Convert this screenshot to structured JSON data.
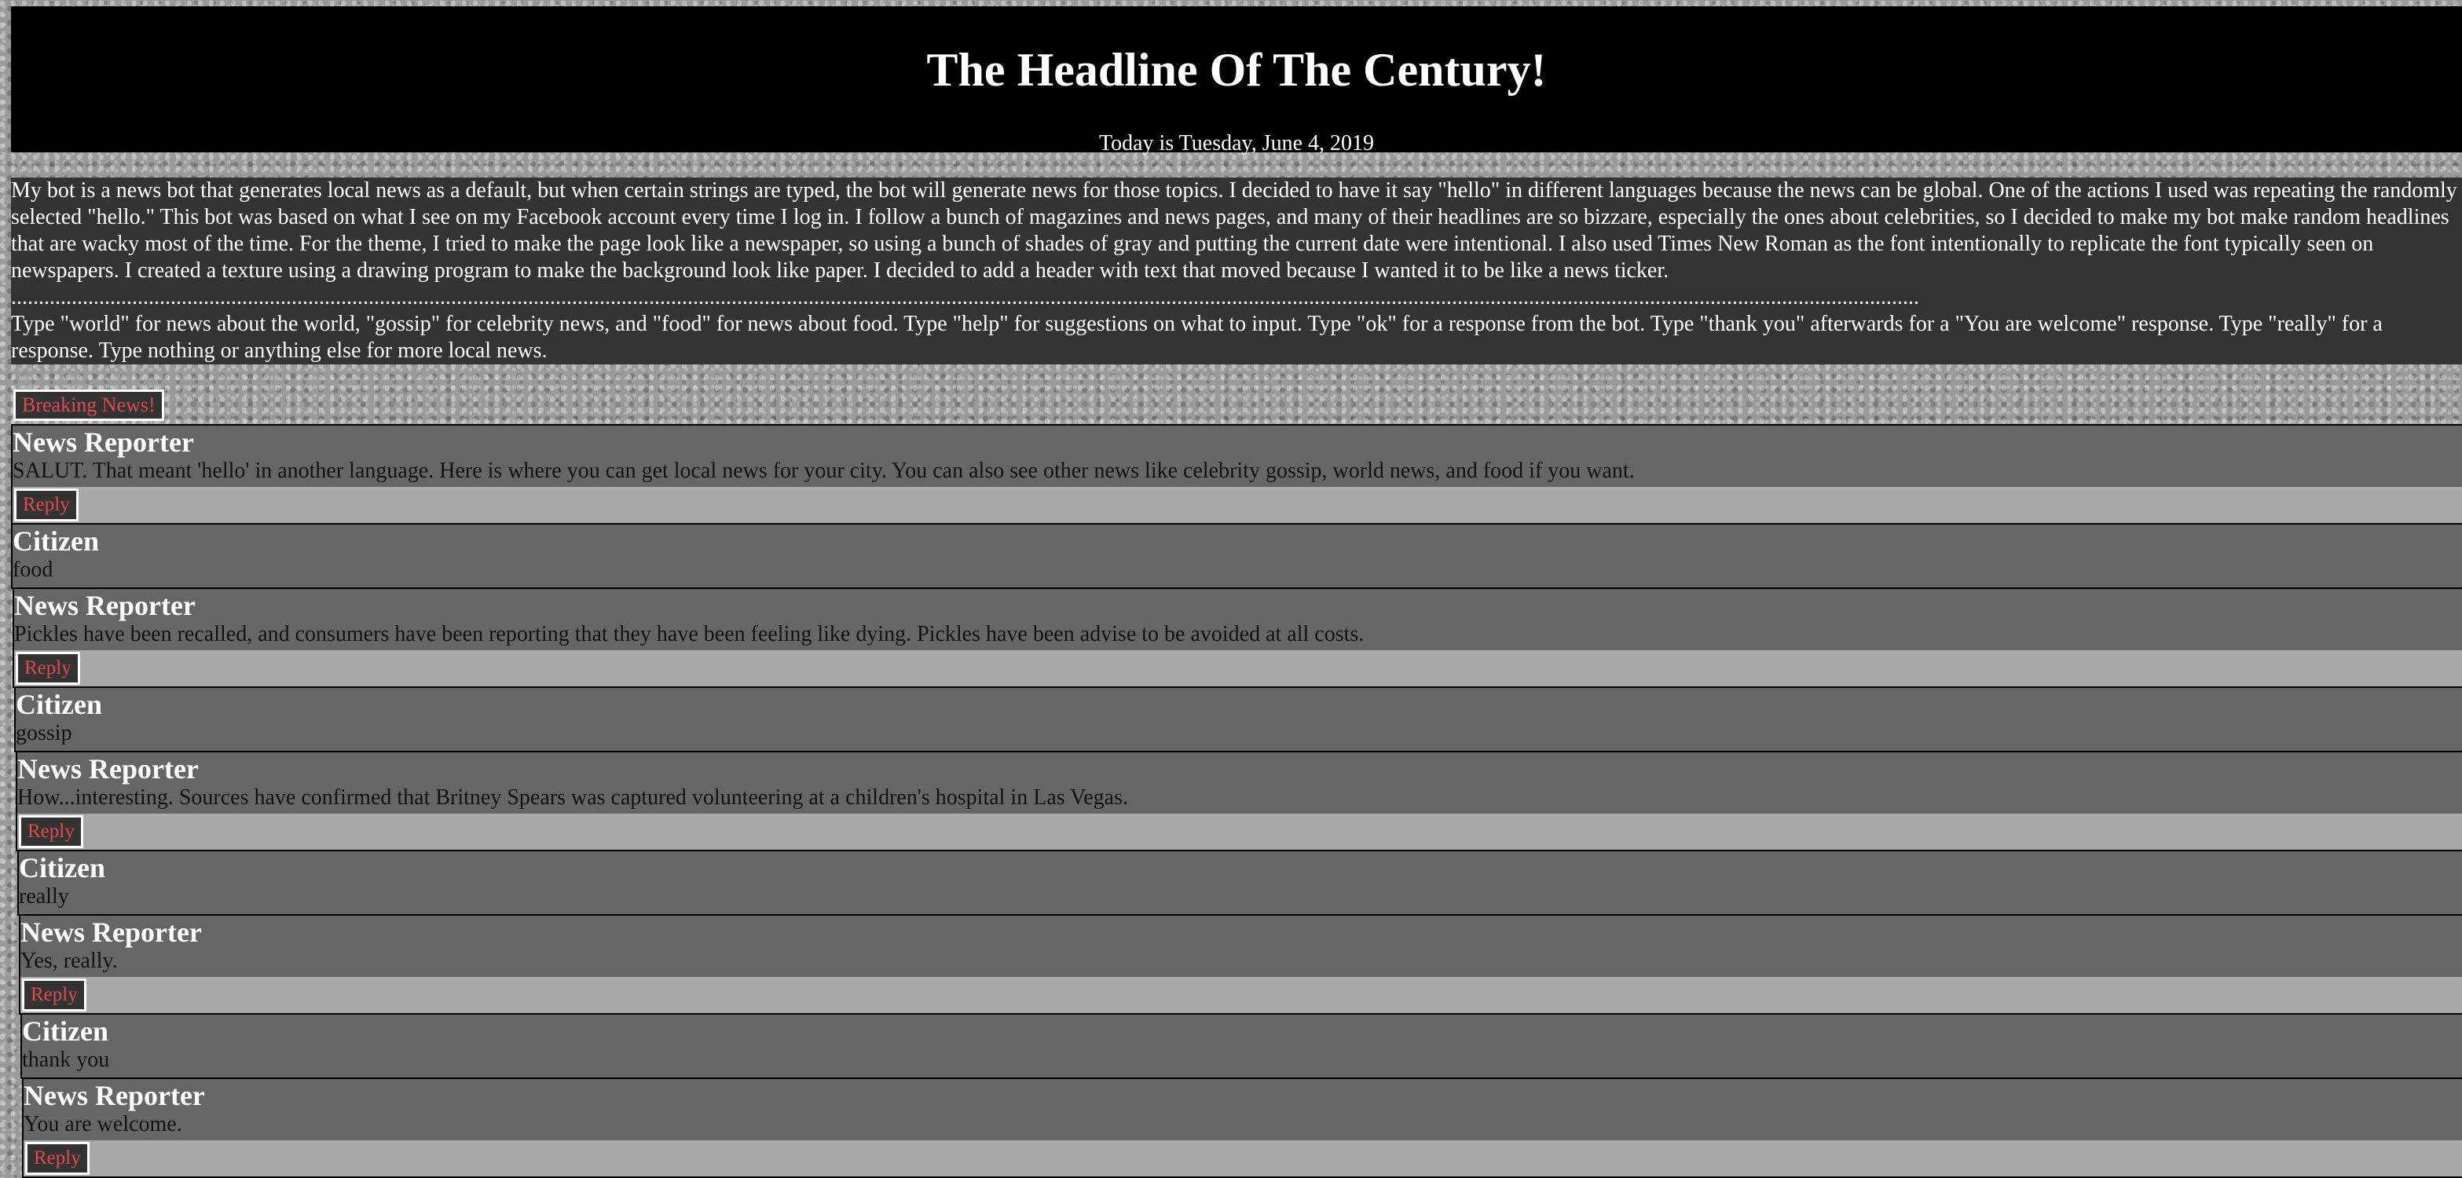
{
  "header": {
    "title": "The Headline Of The Century!",
    "date": "Today is Tuesday, June 4, 2019"
  },
  "description": {
    "paragraph": "My bot is a news bot that generates local news as a default, but when certain strings are typed, the bot will generate news for those topics. I decided to have it say \"hello\" in different languages because the news can be global. One of the actions I used was repeating the randomly selected \"hello.\" This bot was based on what I see on my Facebook account every time I log in. I follow a bunch of magazines and news pages, and many of their headlines are so bizzare, especially the ones about celebrities, so I decided to make my bot make random headlines that are wacky most of the time. For the theme, I tried to make the page look like a newspaper, so using a bunch of shades of gray and putting the current date were intentional. I also used Times New Roman as the font intentionally to replicate the font typically seen on newspapers. I created a texture using a drawing program to make the background look like paper. I decided to add a header with text that moved because I wanted it to be like a news ticker.",
    "divider": "...........................................................................................................................................................................................................................................................................................................................................................",
    "instructions": "Type \"world\" for news about the world, \"gossip\" for celebrity news, and \"food\" for news about food. Type \"help\" for suggestions on what to input. Type \"ok\" for a response from the bot. Type \"thank you\" afterwards for a \"You are welcome\" response. Type \"really\" for a response. Type nothing or anything else for more local news."
  },
  "breaking_button": "Breaking News!",
  "reply_label": "Reply",
  "messages": [
    {
      "speaker": "News Reporter",
      "text": "SALUT. That meant 'hello' in another language. Here is where you can get local news for your city. You can also see other news like celebrity gossip, world news, and food if you want."
    },
    {
      "speaker": "Citizen",
      "text": "food"
    },
    {
      "speaker": "News Reporter",
      "text": "Pickles have been recalled, and consumers have been reporting that they have been feeling like dying. Pickles have been advise to be avoided at all costs."
    },
    {
      "speaker": "Citizen",
      "text": "gossip"
    },
    {
      "speaker": "News Reporter",
      "text": "How...interesting. Sources have confirmed that Britney Spears was captured volunteering at a children's hospital in Las Vegas."
    },
    {
      "speaker": "Citizen",
      "text": "really"
    },
    {
      "speaker": "News Reporter",
      "text": "Yes, really."
    },
    {
      "speaker": "Citizen",
      "text": "thank you"
    },
    {
      "speaker": "News Reporter",
      "text": "You are welcome."
    }
  ]
}
